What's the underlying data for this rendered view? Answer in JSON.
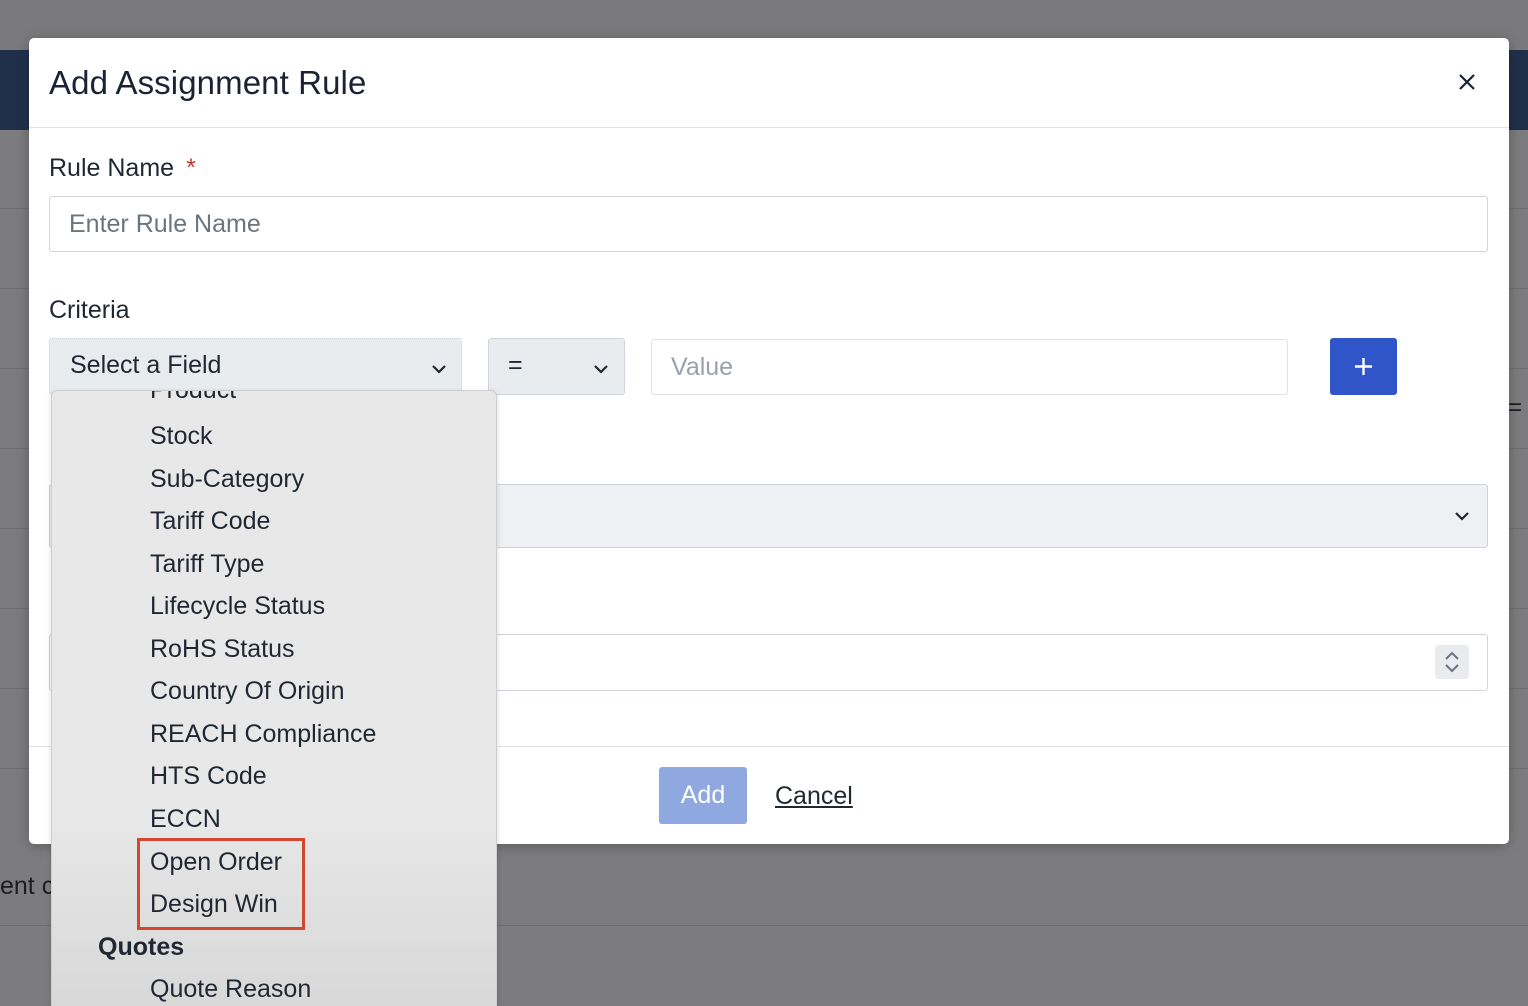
{
  "modal": {
    "title": "Add Assignment Rule",
    "close_icon": "close-icon",
    "rule_name": {
      "label": "Rule Name",
      "required_mark": "*",
      "placeholder": "Enter Rule Name",
      "value": ""
    },
    "criteria": {
      "label": "Criteria",
      "field_select": "Select a Field",
      "operator_select": "=",
      "value_placeholder": "Value",
      "add_icon": "plus-icon"
    },
    "footer": {
      "add_label": "Add",
      "cancel_label": "Cancel"
    }
  },
  "dropdown": {
    "partial_top_item": "Product",
    "items": [
      "Stock",
      "Sub-Category",
      "Tariff Code",
      "Tariff Type",
      "Lifecycle Status",
      "RoHS Status",
      "Country Of Origin",
      "REACH Compliance",
      "HTS Code",
      "ECCN",
      "Open Order",
      "Design Win"
    ],
    "group_label": "Quotes",
    "group_items": [
      "Quote Reason"
    ],
    "highlight_color": "#d4472f"
  },
  "background": {
    "partial_text": "ent c",
    "partial_symbol": "="
  },
  "colors": {
    "primary": "#2f55c8",
    "add_disabled": "#8fa9e0",
    "navbar": "#21304a",
    "required": "#c0392b"
  }
}
